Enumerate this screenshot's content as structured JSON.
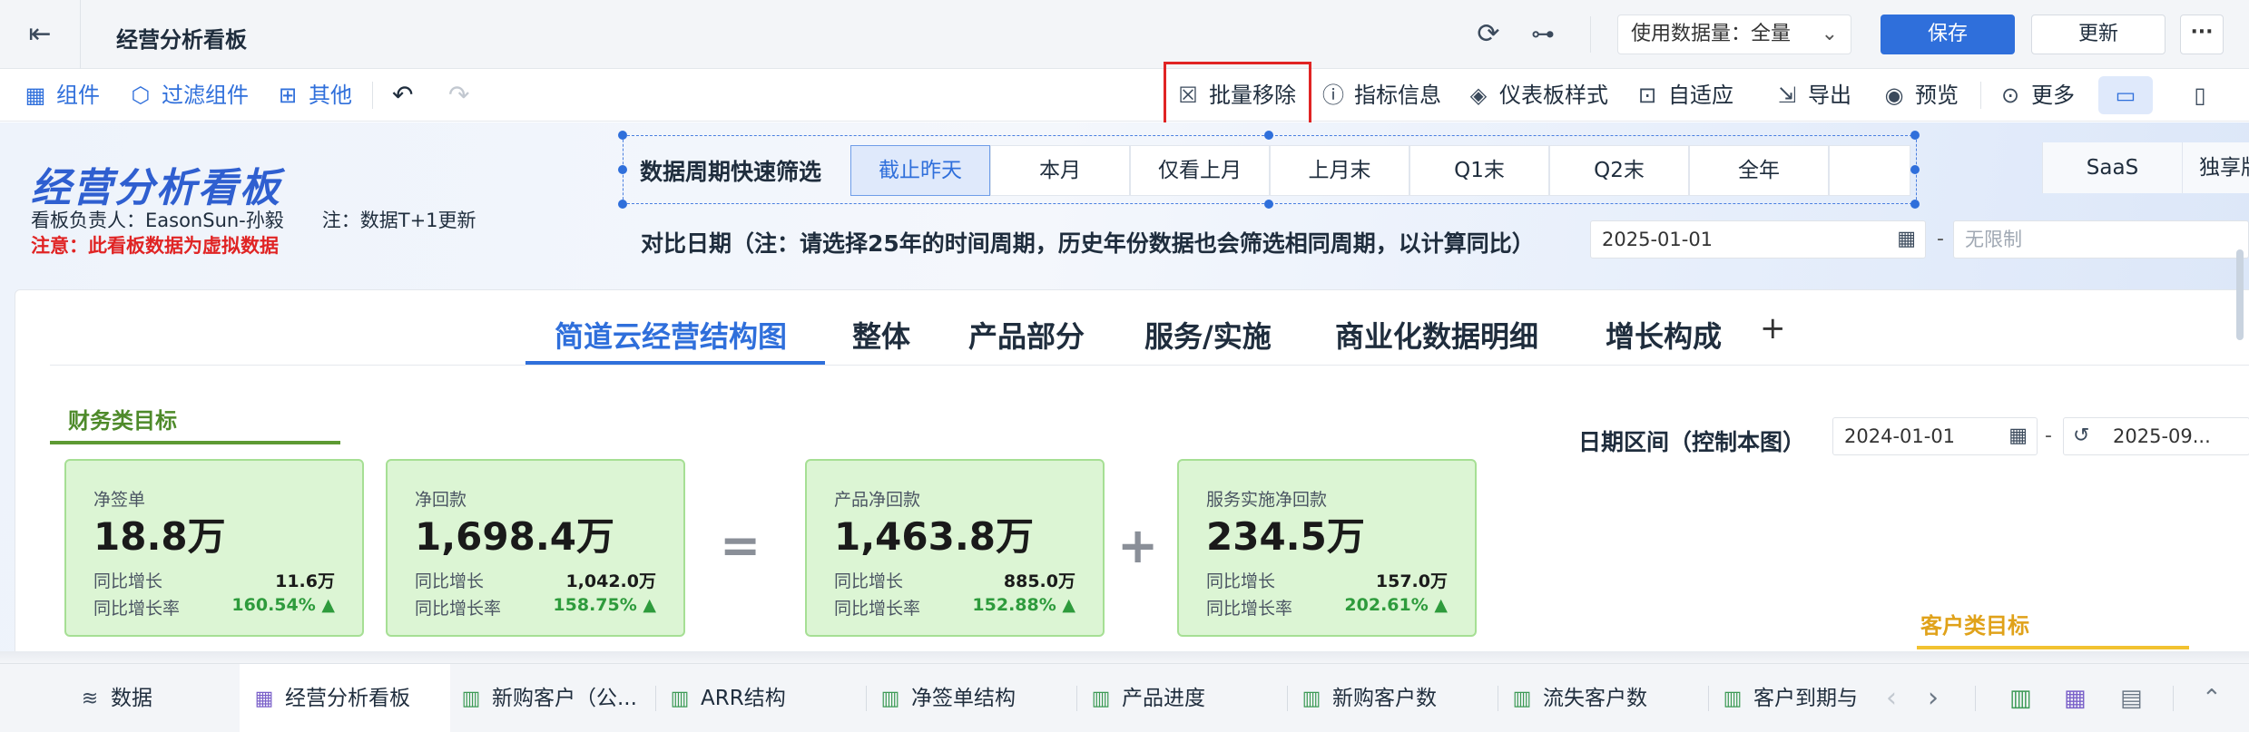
{
  "header": {
    "title": "经营分析看板",
    "dataset_label": "使用数据量：全量",
    "save_label": "保存",
    "update_label": "更新",
    "more_label": "···"
  },
  "toolbar": {
    "component": "组件",
    "filter_component": "过滤组件",
    "other": "其他",
    "batch_remove": "批量移除",
    "metric_info": "指标信息",
    "dashboard_style": "仪表板样式",
    "auto_fit": "自适应",
    "export": "导出",
    "preview": "预览",
    "more": "更多"
  },
  "board": {
    "title": "经营分析看板",
    "owner": "看板负责人：EasonSun-孙毅　　注：数据T+1更新",
    "warning": "注意：此看板数据为虚拟数据",
    "quick_filter_label": "数据周期快速筛选",
    "periods": [
      "截止昨天",
      "本月",
      "仅看上月",
      "上月末",
      "Q1末",
      "Q2末",
      "全年"
    ],
    "active_period": "截止昨天",
    "product_filters": [
      "SaaS",
      "独享版"
    ],
    "compare_label": "对比日期（注：请选择25年的时间周期，历史年份数据也会筛选相同周期，以计算同比）",
    "compare_start": "2025-01-01",
    "compare_end_placeholder": "无限制",
    "range_label": "日期区间（控制本图）",
    "range_start": "2024-01-01",
    "range_end": "2025-09..."
  },
  "tabs": [
    "简道云经营结构图",
    "整体",
    "产品部分",
    "服务/实施",
    "商业化数据明细",
    "增长构成"
  ],
  "active_tab": "简道云经营结构图",
  "sections": {
    "finance": "财务类目标",
    "customer": "客户类目标"
  },
  "kpis": [
    {
      "name": "净签单",
      "value": "18.8万",
      "growth_label": "同比增长",
      "growth": "11.6万",
      "rate_label": "同比增长率",
      "rate": "160.54% ▲"
    },
    {
      "name": "净回款",
      "value": "1,698.4万",
      "growth_label": "同比增长",
      "growth": "1,042.0万",
      "rate_label": "同比增长率",
      "rate": "158.75% ▲"
    },
    {
      "name": "产品净回款",
      "value": "1,463.8万",
      "growth_label": "同比增长",
      "growth": "885.0万",
      "rate_label": "同比增长率",
      "rate": "152.88% ▲"
    },
    {
      "name": "服务实施净回款",
      "value": "234.5万",
      "growth_label": "同比增长",
      "growth": "157.0万",
      "rate_label": "同比增长率",
      "rate": "202.61% ▲"
    }
  ],
  "operators": [
    "=",
    "+"
  ],
  "sheets": {
    "data": "数据",
    "items": [
      "经营分析看板",
      "新购客户（公...",
      "ARR结构",
      "净签单结构",
      "产品进度",
      "新购客户数",
      "流失客户数",
      "客户到期与"
    ]
  },
  "colors": {
    "accent": "#2f6fdb",
    "kpi_bg": "#dcf5d4",
    "finance_title": "#4e8a2a",
    "customer_title": "#e0a21a",
    "warning": "#e02424"
  }
}
